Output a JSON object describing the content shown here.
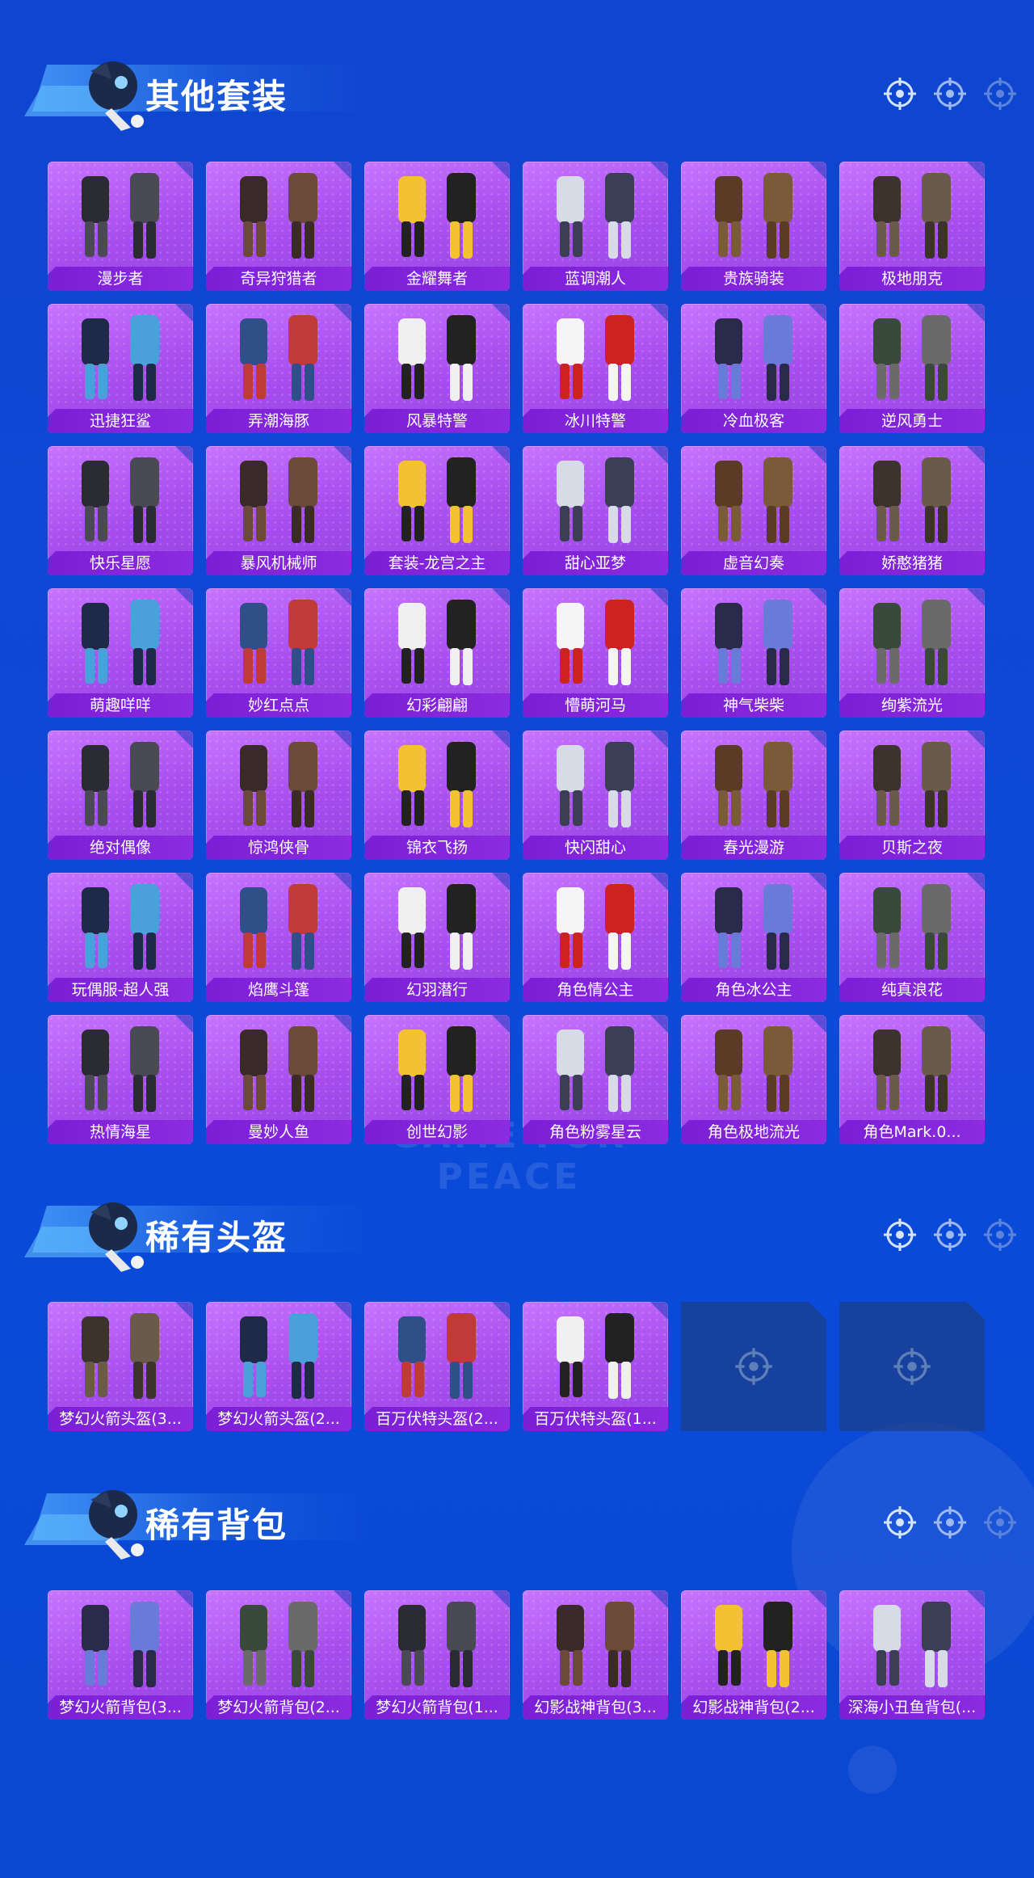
{
  "sections": [
    {
      "title": "其他套装",
      "items": [
        "漫步者",
        "奇异狩猎者",
        "金耀舞者",
        "蓝调潮人",
        "贵族骑装",
        "极地朋克",
        "迅捷狂鲨",
        "弄潮海豚",
        "风暴特警",
        "冰川特警",
        "冷血极客",
        "逆风勇士",
        "快乐星愿",
        "暴风机械师",
        "套装-龙宫之主",
        "甜心亚梦",
        "虚音幻奏",
        "娇憨猪猪",
        "萌趣咩咩",
        "妙红点点",
        "幻彩翩翩",
        "懵萌河马",
        "神气柴柴",
        "绚紫流光",
        "绝对偶像",
        "惊鸿侠骨",
        "锦衣飞扬",
        "快闪甜心",
        "春光漫游",
        "贝斯之夜",
        "玩偶服-超人强",
        "焰鹰斗篷",
        "幻羽潜行",
        "角色情公主",
        "角色冰公主",
        "纯真浪花",
        "热情海星",
        "曼妙人鱼",
        "创世幻影",
        "角色粉雾星云",
        "角色极地流光",
        "角色Mark.0..."
      ],
      "empty_slots": 0
    },
    {
      "title": "稀有头盔",
      "items": [
        "梦幻火箭头盔(3...",
        "梦幻火箭头盔(2...",
        "百万伏特头盔(2...",
        "百万伏特头盔(1..."
      ],
      "empty_slots": 2
    },
    {
      "title": "稀有背包",
      "items": [
        "梦幻火箭背包(3...",
        "梦幻火箭背包(2...",
        "梦幻火箭背包(1...",
        "幻影战神背包(3...",
        "幻影战神背包(2...",
        "深海小丑鱼背包(..."
      ],
      "empty_slots": 0
    }
  ],
  "watermark": "GAME FOR PEACE",
  "icons": {
    "target": "crosshair-icon",
    "mascot": "mascot-icon"
  },
  "colors": {
    "background": "#0d49d6",
    "card": "#a84fee",
    "label_bar": "#7a1fd6",
    "empty_slot": "#1e3c78"
  }
}
